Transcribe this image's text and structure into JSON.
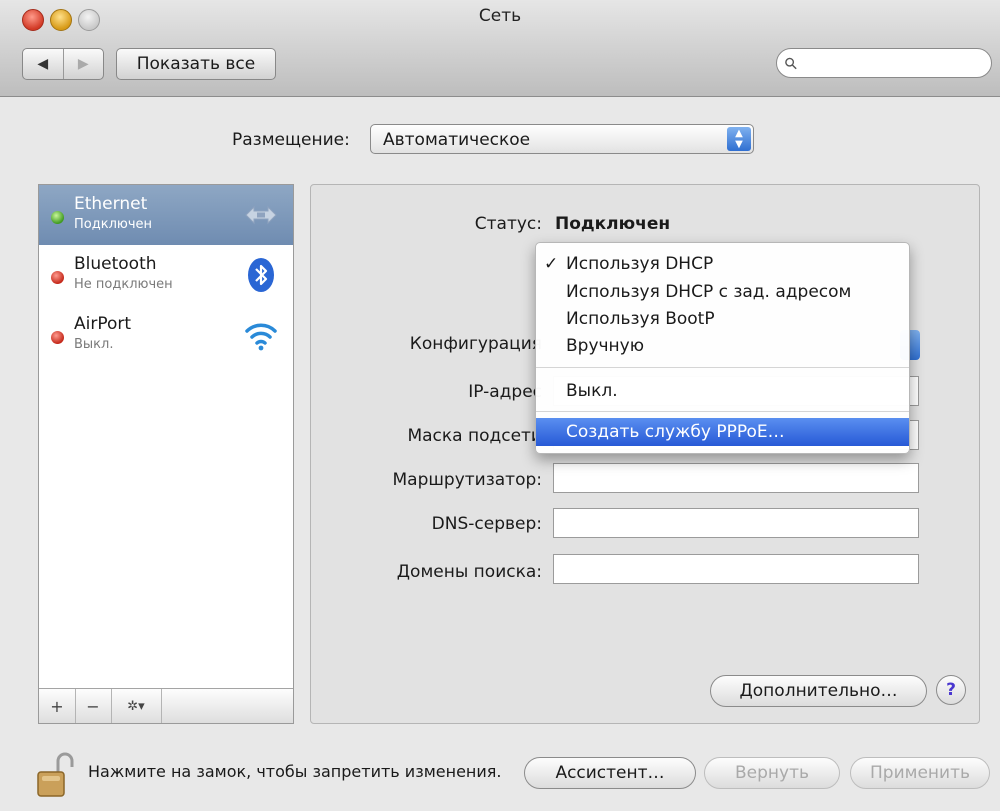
{
  "window": {
    "title": "Сеть"
  },
  "toolbar": {
    "back_label": "◀",
    "forward_label": "▶",
    "show_all_label": "Показать все",
    "search_placeholder": "",
    "search_icon_glyph": "⚲"
  },
  "location": {
    "label": "Размещение:",
    "value": "Автоматическое"
  },
  "services": [
    {
      "name": "Ethernet",
      "status": "Подключен",
      "indicator": "green",
      "icon": "ethernet-icon",
      "selected": true
    },
    {
      "name": "Bluetooth",
      "status": "Не подключен",
      "indicator": "red",
      "icon": "bluetooth-icon",
      "selected": false
    },
    {
      "name": "AirPort",
      "status": "Выкл.",
      "indicator": "red",
      "icon": "wifi-icon",
      "selected": false
    }
  ],
  "sidebar_footer": {
    "add_label": "+",
    "remove_label": "−",
    "action_label": "✲▾"
  },
  "details": {
    "status_label": "Статус:",
    "status_value": "Подключен",
    "configuration_label": "Конфигурация",
    "ip_label": "IP-адрес",
    "subnet_label": "Маска подсети",
    "router_label": "Маршрутизатор:",
    "dns_label": "DNS-сервер:",
    "search_domains_label": "Домены поиска:",
    "router_value": "",
    "dns_value": "",
    "search_domains_value": ""
  },
  "config_menu": {
    "check_glyph": "✓",
    "items": [
      "Используя DHCP",
      "Используя DHCP с зад. адресом",
      "Используя BootP",
      "Вручную",
      "Выкл.",
      "Создать службу PPPoE…"
    ],
    "checked_index": 0,
    "highlighted_index": 5
  },
  "buttons": {
    "advanced": "Дополнительно…",
    "help": "?",
    "assistant": "Ассистент…",
    "revert": "Вернуть",
    "apply": "Применить"
  },
  "lock_message": "Нажмите на замок, чтобы запретить изменения.",
  "colors": {
    "selection": "#7993b6",
    "menu_highlight": "#2f63dc",
    "accent_blue": "#2f6fd1"
  }
}
